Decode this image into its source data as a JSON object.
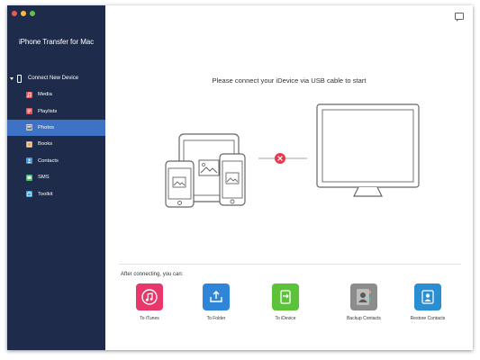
{
  "app": {
    "title": "iPhone Transfer for Mac"
  },
  "sidebar": {
    "device_label": "Connect New Device",
    "items": [
      {
        "label": "Media",
        "icon": "music-note-icon",
        "color": "#e85a5a"
      },
      {
        "label": "Playlists",
        "icon": "playlist-icon",
        "color": "#e05656"
      },
      {
        "label": "Photos",
        "icon": "photo-icon",
        "color": "#d8d8d8",
        "active": true
      },
      {
        "label": "Books",
        "icon": "book-icon",
        "color": "#f09a3a"
      },
      {
        "label": "Contacts",
        "icon": "contact-icon",
        "color": "#3a9be6"
      },
      {
        "label": "SMS",
        "icon": "message-icon",
        "color": "#4cc16a"
      },
      {
        "label": "Toolkit",
        "icon": "toolkit-icon",
        "color": "#3aa0e6"
      }
    ]
  },
  "main": {
    "connect_message": "Please connect your iDevice via USB cable to start",
    "after_label": "After connecting, you can:",
    "actions": [
      {
        "label": "To iTunes",
        "icon": "itunes-icon",
        "color": "#e8376a"
      },
      {
        "label": "To Folder",
        "icon": "folder-export-icon",
        "color": "#2f86d8"
      },
      {
        "label": "To iDevice",
        "icon": "device-transfer-icon",
        "color": "#5cc23a"
      },
      {
        "label": "Backup Contacts",
        "icon": "backup-contacts-icon",
        "color": "#8c8c8c"
      },
      {
        "label": "Restore Contacts",
        "icon": "restore-contacts-icon",
        "color": "#2a8fd0"
      }
    ]
  },
  "colors": {
    "sidebar_bg": "#1f2b4a",
    "active_item": "#3d72c4",
    "disconnect_badge": "#e8394a"
  }
}
